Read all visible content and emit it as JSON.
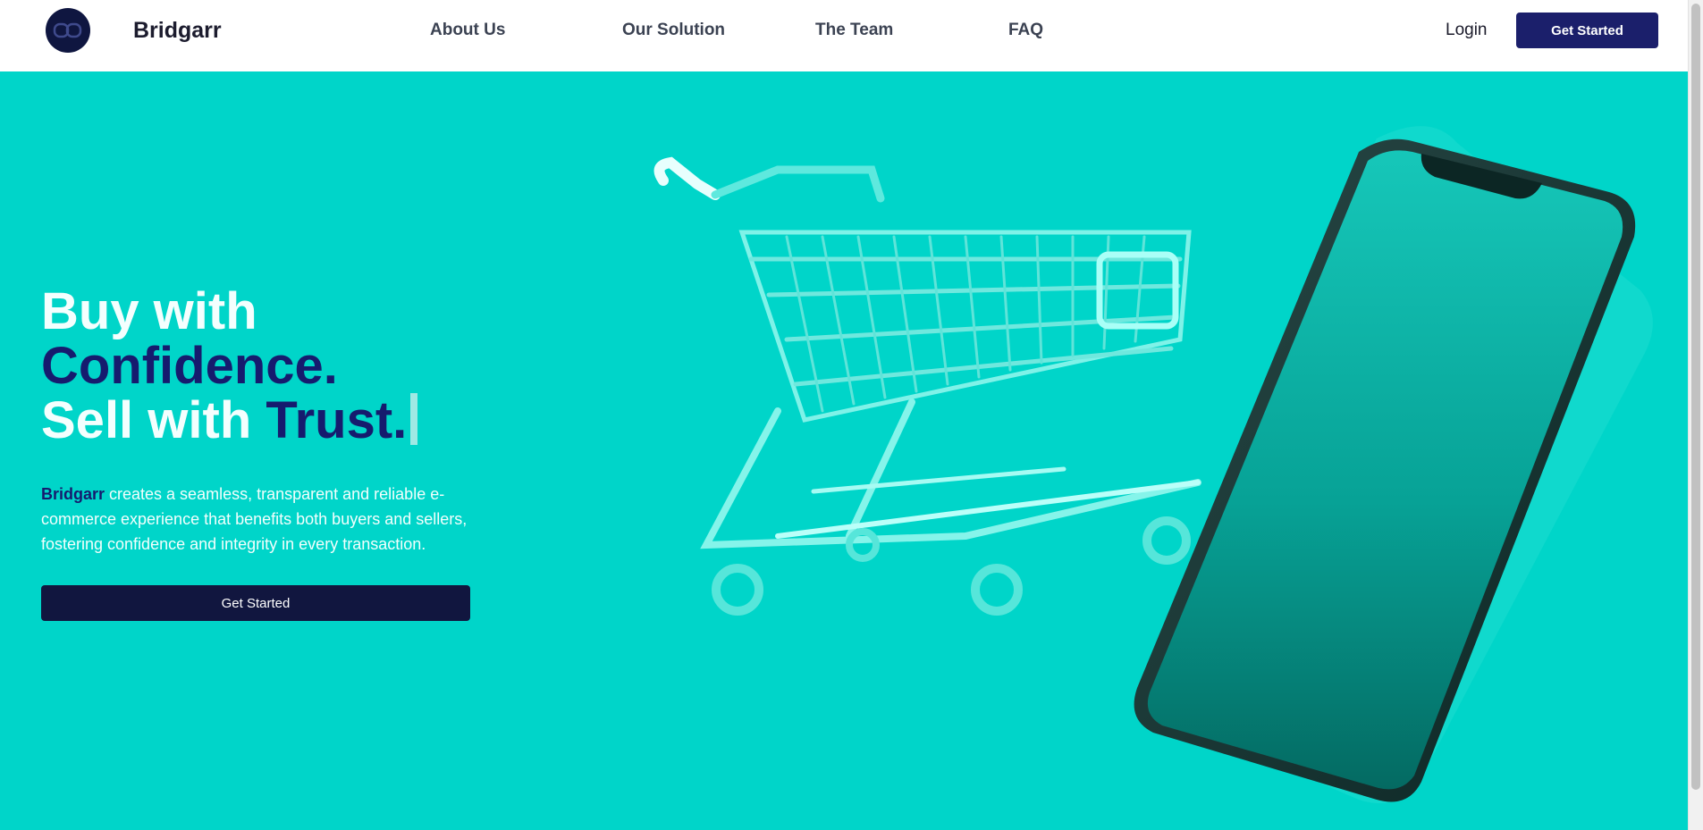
{
  "header": {
    "brand": "Bridgarr",
    "nav": [
      "About Us",
      "Our Solution",
      "The Team",
      "FAQ"
    ],
    "login": "Login",
    "cta": "Get Started"
  },
  "hero": {
    "line1": "Buy with",
    "line2": "Confidence.",
    "line3_prefix": "Sell with ",
    "line3_accent": "Trust.",
    "brand_inline": "Bridgarr",
    "description": " creates a seamless, transparent and reliable e-commerce experience that benefits both buyers and sellers, fostering confidence and integrity in every transaction.",
    "cta": "Get Started"
  },
  "colors": {
    "background": "#00d5c9",
    "navy": "#161b6e",
    "button_dark": "#11163f",
    "header_button": "#1b1f6b"
  },
  "icons": [
    "brand-logo-icon",
    "shopping-cart-illustration",
    "smartphone-illustration"
  ]
}
